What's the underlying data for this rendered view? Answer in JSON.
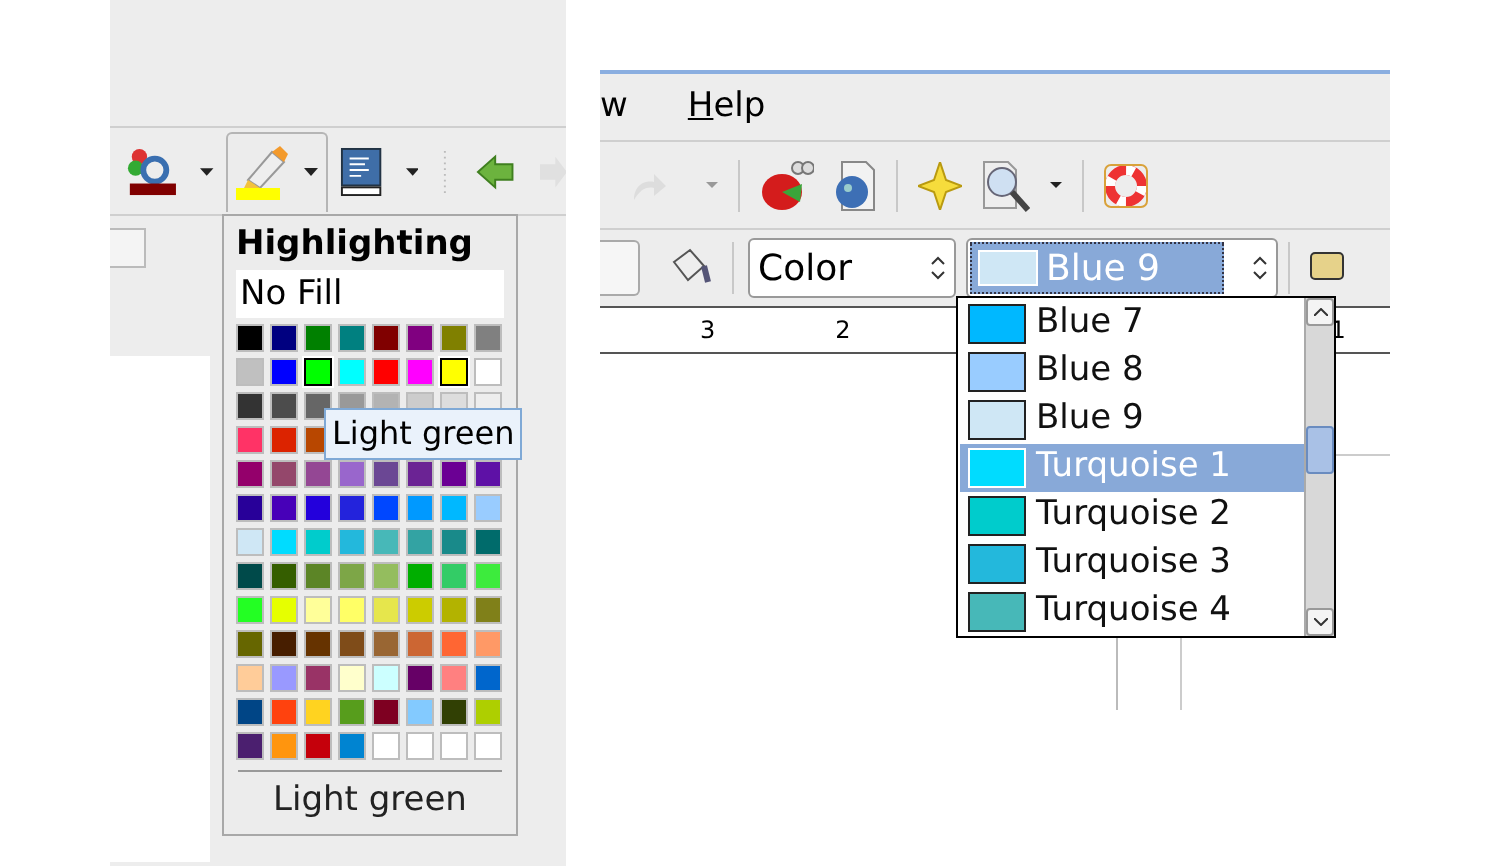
{
  "left_window": {
    "highlight_popup": {
      "title": "Highlighting",
      "no_fill": "No Fill",
      "swatch_rows": [
        [
          {
            "color": "#000000",
            "selected": false
          },
          {
            "color": "#000080",
            "selected": false
          },
          {
            "color": "#008000",
            "selected": false
          },
          {
            "color": "#008080",
            "selected": false
          },
          {
            "color": "#800000",
            "selected": false
          },
          {
            "color": "#800080",
            "selected": false
          },
          {
            "color": "#808000",
            "selected": false
          },
          {
            "color": "#808080",
            "selected": false
          }
        ],
        [
          {
            "color": "#c0c0c0",
            "selected": false
          },
          {
            "color": "#0000ff",
            "selected": false
          },
          {
            "color": "#00ff00",
            "selected": true
          },
          {
            "color": "#00ffff",
            "selected": false
          },
          {
            "color": "#ff0000",
            "selected": false
          },
          {
            "color": "#ff00ff",
            "selected": false
          },
          {
            "color": "#ffff00",
            "selected": true
          },
          {
            "color": "#ffffff",
            "selected": false
          }
        ],
        [
          {
            "color": "#333333",
            "selected": false
          },
          {
            "color": "#4c4c4c",
            "selected": false
          },
          {
            "color": "#666666",
            "selected": false
          },
          {
            "color": "#999999",
            "selected": false
          },
          {
            "color": "#b3b3b3",
            "selected": false
          },
          {
            "color": "#cccccc",
            "selected": false
          },
          {
            "color": "#dddddd",
            "selected": false
          },
          {
            "color": "#eeeeee",
            "selected": false
          }
        ],
        [
          {
            "color": "#ff3366",
            "selected": false
          },
          {
            "color": "#dc2300",
            "selected": false
          },
          {
            "color": "#b84700",
            "selected": false
          }
        ],
        [
          {
            "color": "#94006b",
            "selected": false
          },
          {
            "color": "#94476b",
            "selected": false
          },
          {
            "color": "#944794",
            "selected": false
          },
          {
            "color": "#9966cc",
            "selected": false
          },
          {
            "color": "#6b4794",
            "selected": false
          },
          {
            "color": "#6b2394",
            "selected": false
          },
          {
            "color": "#6b0094",
            "selected": false
          },
          {
            "color": "#5e11a6",
            "selected": false
          }
        ],
        [
          {
            "color": "#280099",
            "selected": false
          },
          {
            "color": "#4700b8",
            "selected": false
          },
          {
            "color": "#2300dc",
            "selected": false
          },
          {
            "color": "#2323dc",
            "selected": false
          },
          {
            "color": "#0047ff",
            "selected": false
          },
          {
            "color": "#0099ff",
            "selected": false
          },
          {
            "color": "#00b8ff",
            "selected": false
          },
          {
            "color": "#99ccff",
            "selected": false
          }
        ],
        [
          {
            "color": "#cfe7f5",
            "selected": false
          },
          {
            "color": "#00dcff",
            "selected": false
          },
          {
            "color": "#00cccc",
            "selected": false
          },
          {
            "color": "#23b8dc",
            "selected": false
          },
          {
            "color": "#47b8b8",
            "selected": false
          },
          {
            "color": "#33a3a3",
            "selected": false
          },
          {
            "color": "#198a8a",
            "selected": false
          },
          {
            "color": "#006b6b",
            "selected": false
          }
        ],
        [
          {
            "color": "#004a4a",
            "selected": false
          },
          {
            "color": "#355e00",
            "selected": false
          },
          {
            "color": "#5c8526",
            "selected": false
          },
          {
            "color": "#7da647",
            "selected": false
          },
          {
            "color": "#94bd5e",
            "selected": false
          },
          {
            "color": "#00ae00",
            "selected": false
          },
          {
            "color": "#33cc66",
            "selected": false
          },
          {
            "color": "#3deb3d",
            "selected": false
          }
        ],
        [
          {
            "color": "#23ff23",
            "selected": false
          },
          {
            "color": "#e6ff00",
            "selected": false
          },
          {
            "color": "#ffff99",
            "selected": false
          },
          {
            "color": "#ffff66",
            "selected": false
          },
          {
            "color": "#e6e64c",
            "selected": false
          },
          {
            "color": "#cccc00",
            "selected": false
          },
          {
            "color": "#b3b300",
            "selected": false
          },
          {
            "color": "#808019",
            "selected": false
          }
        ],
        [
          {
            "color": "#666600",
            "selected": false
          },
          {
            "color": "#471e00",
            "selected": false
          },
          {
            "color": "#663300",
            "selected": false
          },
          {
            "color": "#7f4c19",
            "selected": false
          },
          {
            "color": "#996633",
            "selected": false
          },
          {
            "color": "#cc6633",
            "selected": false
          },
          {
            "color": "#ff6633",
            "selected": false
          },
          {
            "color": "#ff9966",
            "selected": false
          }
        ],
        [
          {
            "color": "#ffcc99",
            "selected": false
          },
          {
            "color": "#9999ff",
            "selected": false
          },
          {
            "color": "#993366",
            "selected": false
          },
          {
            "color": "#ffffcc",
            "selected": false
          },
          {
            "color": "#ccffff",
            "selected": false
          },
          {
            "color": "#660066",
            "selected": false
          },
          {
            "color": "#ff8080",
            "selected": false
          },
          {
            "color": "#0066cc",
            "selected": false
          }
        ],
        [
          {
            "color": "#004586",
            "selected": false
          },
          {
            "color": "#ff420e",
            "selected": false
          },
          {
            "color": "#ffd320",
            "selected": false
          },
          {
            "color": "#579d1c",
            "selected": false
          },
          {
            "color": "#7e0021",
            "selected": false
          },
          {
            "color": "#83caff",
            "selected": false
          },
          {
            "color": "#314004",
            "selected": false
          },
          {
            "color": "#aecf00",
            "selected": false
          }
        ],
        [
          {
            "color": "#4b1f6f",
            "selected": false
          },
          {
            "color": "#ff950e",
            "selected": false
          },
          {
            "color": "#c5000b",
            "selected": false
          },
          {
            "color": "#0084d1",
            "selected": false
          },
          {
            "color": "#ffffff",
            "selected": false
          },
          {
            "color": "#ffffff",
            "selected": false
          },
          {
            "color": "#ffffff",
            "selected": false
          },
          {
            "color": "#ffffff",
            "selected": false
          }
        ]
      ],
      "tooltip": "Light green",
      "status": "Light green"
    }
  },
  "right_window": {
    "menu": [
      {
        "label": "w"
      },
      {
        "label": "Help"
      }
    ],
    "area_style": "Color",
    "color_box": {
      "value": "Blue 9",
      "color": "#cfe7f5"
    },
    "ruler_labels": [
      "3",
      "2",
      "1"
    ],
    "color_list": [
      {
        "label": "Blue 7",
        "color": "#00b8ff",
        "selected": false
      },
      {
        "label": "Blue 8",
        "color": "#99ccff",
        "selected": false
      },
      {
        "label": "Blue 9",
        "color": "#cfe7f5",
        "selected": false
      },
      {
        "label": "Turquoise 1",
        "color": "#00dcff",
        "selected": true
      },
      {
        "label": "Turquoise 2",
        "color": "#00cccc",
        "selected": false
      },
      {
        "label": "Turquoise 3",
        "color": "#23b8dc",
        "selected": false
      },
      {
        "label": "Turquoise 4",
        "color": "#47b8b8",
        "selected": false
      }
    ]
  }
}
